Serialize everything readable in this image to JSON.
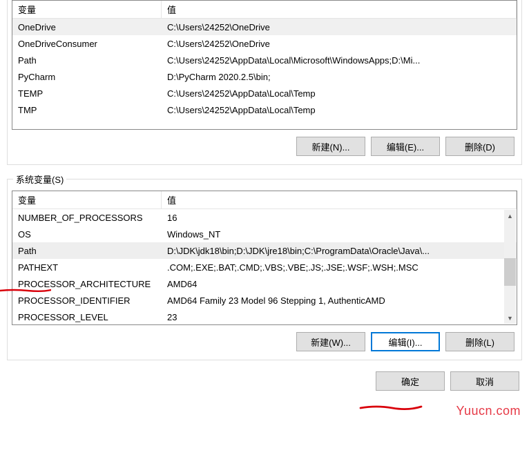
{
  "userVars": {
    "header": {
      "variable": "变量",
      "value": "值"
    },
    "rows": [
      {
        "name": "OneDrive",
        "value": "C:\\Users\\24252\\OneDrive",
        "selected": true
      },
      {
        "name": "OneDriveConsumer",
        "value": "C:\\Users\\24252\\OneDrive",
        "selected": false
      },
      {
        "name": "Path",
        "value": "C:\\Users\\24252\\AppData\\Local\\Microsoft\\WindowsApps;D:\\Mi...",
        "selected": false
      },
      {
        "name": "PyCharm",
        "value": "D:\\PyCharm 2020.2.5\\bin;",
        "selected": false
      },
      {
        "name": "TEMP",
        "value": "C:\\Users\\24252\\AppData\\Local\\Temp",
        "selected": false
      },
      {
        "name": "TMP",
        "value": "C:\\Users\\24252\\AppData\\Local\\Temp",
        "selected": false
      }
    ],
    "buttons": {
      "new": "新建(N)...",
      "edit": "编辑(E)...",
      "delete": "删除(D)"
    }
  },
  "systemVars": {
    "label": "系统变量(S)",
    "header": {
      "variable": "变量",
      "value": "值"
    },
    "rows": [
      {
        "name": "NUMBER_OF_PROCESSORS",
        "value": "16",
        "selected": false
      },
      {
        "name": "OS",
        "value": "Windows_NT",
        "selected": false
      },
      {
        "name": "Path",
        "value": "D:\\JDK\\jdk18\\bin;D:\\JDK\\jre18\\bin;C:\\ProgramData\\Oracle\\Java\\...",
        "selected": true
      },
      {
        "name": "PATHEXT",
        "value": ".COM;.EXE;.BAT;.CMD;.VBS;.VBE;.JS;.JSE;.WSF;.WSH;.MSC",
        "selected": false
      },
      {
        "name": "PROCESSOR_ARCHITECTURE",
        "value": "AMD64",
        "selected": false
      },
      {
        "name": "PROCESSOR_IDENTIFIER",
        "value": "AMD64 Family 23 Model 96 Stepping 1, AuthenticAMD",
        "selected": false
      },
      {
        "name": "PROCESSOR_LEVEL",
        "value": "23",
        "selected": false
      }
    ],
    "buttons": {
      "new": "新建(W)...",
      "edit": "编辑(I)...",
      "delete": "删除(L)"
    }
  },
  "dialogButtons": {
    "ok": "确定",
    "cancel": "取消"
  },
  "watermark": "Yuucn.com"
}
